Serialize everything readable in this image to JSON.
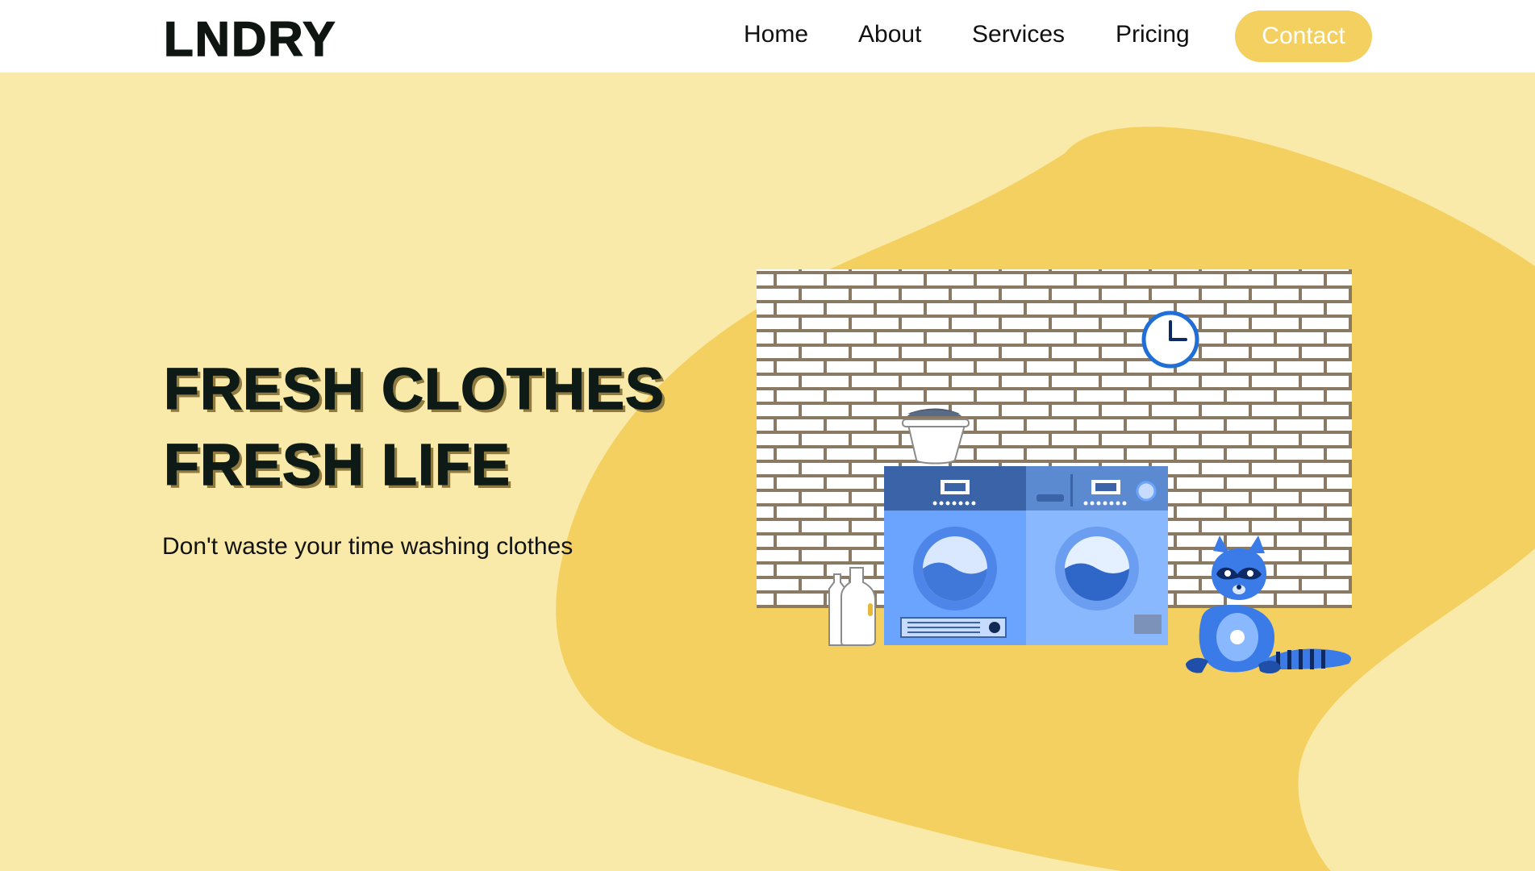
{
  "header": {
    "logo": "LNDRY",
    "nav": [
      {
        "label": "Home"
      },
      {
        "label": "About"
      },
      {
        "label": "Services"
      },
      {
        "label": "Pricing"
      }
    ],
    "contact_label": "Contact"
  },
  "hero": {
    "headline_line1": "FRESH CLOTHES",
    "headline_line2": "FRESH LIFE",
    "subtitle": "Don't waste your time washing clothes"
  },
  "colors": {
    "page_background": "#f9eaa9",
    "blob": "#f4d060",
    "accent": "#f4d060",
    "headline_shadow": "#8f7a3f",
    "machine_blue": "#6aa4ff",
    "machine_dark": "#3b63a8"
  },
  "illustration": {
    "icons": [
      "brick-wall",
      "wall-clock",
      "laundry-basket",
      "washing-machine",
      "dryer",
      "detergent-bottles",
      "raccoon"
    ]
  }
}
